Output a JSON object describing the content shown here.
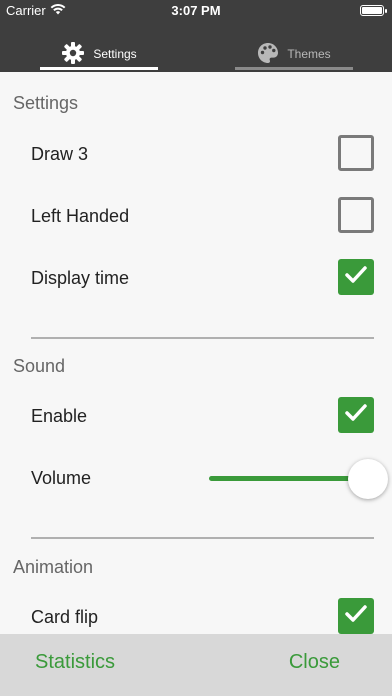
{
  "status_bar": {
    "carrier": "Carrier",
    "time": "3:07 PM"
  },
  "tabs": [
    {
      "label": "Settings",
      "icon": "gear-icon",
      "active": true
    },
    {
      "label": "Themes",
      "icon": "palette-icon",
      "active": false
    }
  ],
  "sections": {
    "settings": {
      "title": "Settings",
      "draw3": {
        "label": "Draw 3",
        "checked": false
      },
      "left_handed": {
        "label": "Left Handed",
        "checked": false
      },
      "display_time": {
        "label": "Display time",
        "checked": true
      }
    },
    "sound": {
      "title": "Sound",
      "enable": {
        "label": "Enable",
        "checked": true
      },
      "volume": {
        "label": "Volume",
        "value": 1.0
      }
    },
    "animation": {
      "title": "Animation",
      "card_flip": {
        "label": "Card flip",
        "checked": true
      }
    }
  },
  "bottom_bar": {
    "statistics_label": "Statistics",
    "close_label": "Close"
  },
  "colors": {
    "accent": "#3a9a3a",
    "header_bg": "#3e3e3e",
    "bottom_bg": "#d8d8d8"
  }
}
